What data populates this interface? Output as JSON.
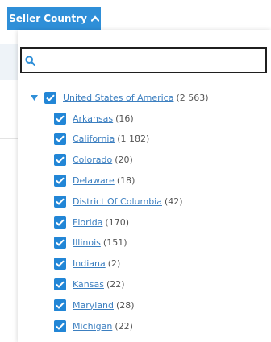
{
  "filter_button": {
    "label": "Seller Country"
  },
  "search": {
    "value": "",
    "placeholder": ""
  },
  "tree": {
    "parent": {
      "label": "United States of America",
      "count": "(2 563)",
      "checked": true,
      "expanded": true
    },
    "children": [
      {
        "label": "Arkansas",
        "count": "(16)",
        "checked": true
      },
      {
        "label": "California",
        "count": "(1 182)",
        "checked": true
      },
      {
        "label": "Colorado",
        "count": "(20)",
        "checked": true
      },
      {
        "label": "Delaware",
        "count": "(18)",
        "checked": true
      },
      {
        "label": "District Of Columbia",
        "count": "(42)",
        "checked": true
      },
      {
        "label": "Florida",
        "count": "(170)",
        "checked": true
      },
      {
        "label": "Illinois",
        "count": "(151)",
        "checked": true
      },
      {
        "label": "Indiana",
        "count": "(2)",
        "checked": true
      },
      {
        "label": "Kansas",
        "count": "(22)",
        "checked": true
      },
      {
        "label": "Maryland",
        "count": "(28)",
        "checked": true
      },
      {
        "label": "Michigan",
        "count": "(22)",
        "checked": true
      }
    ]
  },
  "colors": {
    "button_bg": "#2f8fd8",
    "checkbox_bg": "#2286d6",
    "link": "#3c7fc0",
    "caret": "#2f8fd8"
  }
}
